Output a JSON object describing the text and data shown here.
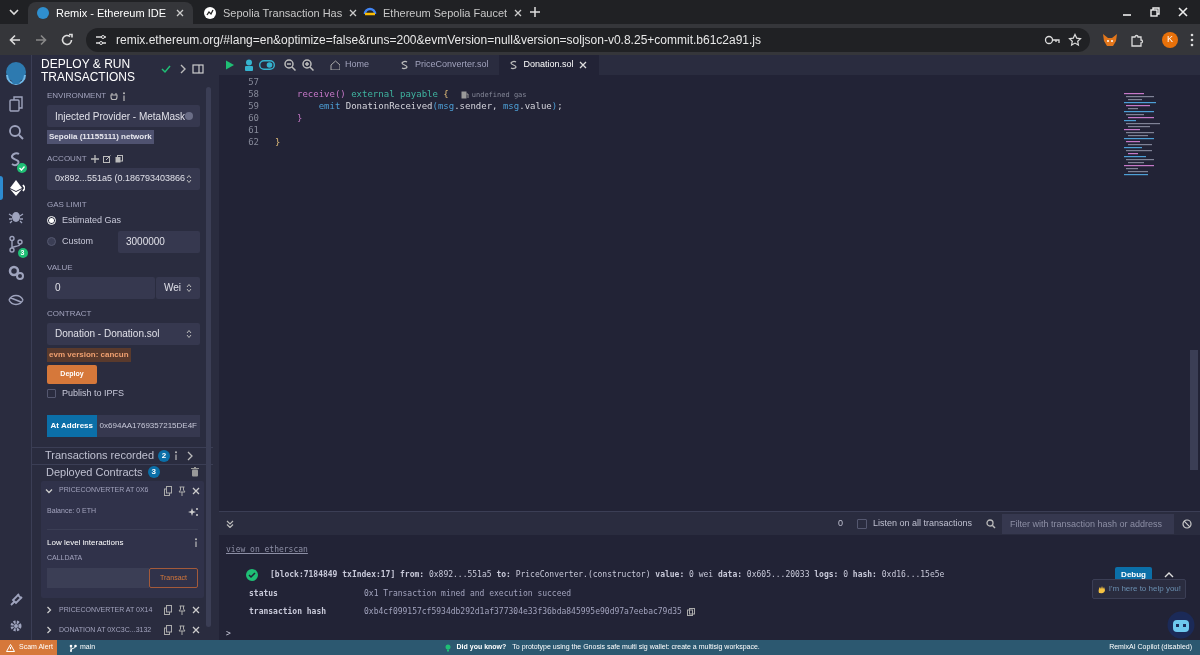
{
  "browser": {
    "tabs": [
      {
        "title": "Remix - Ethereum IDE",
        "selected": true
      },
      {
        "title": "Sepolia Transaction Has",
        "selected": false
      },
      {
        "title": "Ethereum Sepolia Faucet",
        "selected": false
      }
    ],
    "url": "remix.ethereum.org/#lang=en&optimize=false&runs=200&evmVersion=null&version=soljson-v0.8.25+commit.b61c2a91.js",
    "profile": "K"
  },
  "icon_rail": {
    "items": [
      {
        "kind": "files",
        "selected": false
      },
      {
        "kind": "search",
        "selected": false
      },
      {
        "kind": "compiler",
        "selected": false
      },
      {
        "kind": "deploy",
        "selected": true
      },
      {
        "kind": "debug",
        "selected": false
      },
      {
        "kind": "git",
        "selected": false,
        "badge": "3"
      },
      {
        "kind": "settings",
        "selected": false
      },
      {
        "kind": "learn",
        "selected": false
      }
    ]
  },
  "side_panel": {
    "title": "DEPLOY & RUN TRANSACTIONS",
    "environment": {
      "label": "ENVIRONMENT",
      "value": "Injected Provider - MetaMask",
      "network": "Sepolia (11155111) network"
    },
    "account": {
      "label": "ACCOUNT",
      "value": "0x892...551a5 (0.186793403866"
    },
    "gas_limit": {
      "label": "GAS LIMIT",
      "options": [
        {
          "label": "Estimated Gas",
          "selected": true
        },
        {
          "label": "Custom",
          "selected": false
        }
      ],
      "custom_value": "3000000"
    },
    "value": {
      "label": "VALUE",
      "amount": "0",
      "unit": "Wei"
    },
    "contract": {
      "label": "CONTRACT",
      "value": "Donation - Donation.sol",
      "evm_badge": "evm version: cancun"
    },
    "deploy_button": "Deploy",
    "publish": {
      "label": "Publish to IPFS",
      "checked": false
    },
    "at_address": {
      "button": "At Address",
      "value": "0x694AA1769357215DE4F"
    },
    "transactions_recorded": {
      "label": "Transactions recorded",
      "count": "2"
    },
    "deployed": {
      "label": "Deployed Contracts",
      "count": "3",
      "contracts": [
        {
          "name": "PRICECONVERTER AT 0X6",
          "expanded": true
        },
        {
          "name": "PRICECONVERTER AT 0X14",
          "expanded": false
        },
        {
          "name": "DONATION AT 0XC3C...3132",
          "expanded": false
        }
      ],
      "balance": "Balance: 0 ETH",
      "low_level": "Low level interactions",
      "calldata": "CALLDATA",
      "transact": "Transact"
    }
  },
  "editor": {
    "tabs": [
      {
        "label": "Home",
        "kind": "home",
        "selected": false
      },
      {
        "label": "PriceConverter.sol",
        "kind": "file",
        "selected": false
      },
      {
        "label": "Donation.sol",
        "kind": "file",
        "selected": true
      }
    ],
    "lines": [
      {
        "number": "57"
      },
      {
        "number": "58",
        "tokens": [
          {
            "text": "receive()",
            "kind": "fn"
          },
          {
            "text": " external payable",
            "kind": "modifier"
          },
          {
            "text": " {",
            "kind": "brace"
          }
        ],
        "hint": "undefined gas"
      },
      {
        "number": "59",
        "tokens": [
          {
            "text": "    emit",
            "kind": "keyword"
          },
          {
            "text": " DonationReceived"
          },
          {
            "text": "(",
            "kind": "keyword"
          },
          {
            "text": "msg",
            "kind": "keyword"
          },
          {
            "text": ".sender, "
          },
          {
            "text": "msg",
            "kind": "keyword"
          },
          {
            "text": ".value"
          },
          {
            "text": ")",
            "kind": "keyword"
          },
          {
            "text": ";"
          }
        ]
      },
      {
        "number": "60",
        "tokens": [
          {
            "text": "}",
            "kind": "fn"
          }
        ]
      },
      {
        "number": "61"
      },
      {
        "number": "62",
        "tokens": [
          {
            "text": "}",
            "kind": "brace"
          }
        ],
        "outer": true
      }
    ]
  },
  "terminal": {
    "count": "0",
    "listen": {
      "label": "Listen on all transactions",
      "checked": false
    },
    "filter_placeholder": "Filter with transaction hash or address",
    "link": "view on etherscan",
    "summary": "**[block:7184849 txIndex:17]  from:** 0x892...551a5 **to:** PriceConverter.(constructor) **value:** 0 wei **data:** 0x605...20033 **logs:** 0 **hash:** 0xd16...15e5e",
    "debug": "Debug",
    "rows": [
      {
        "key": "status",
        "value": "0x1 Transaction mined and execution succeed"
      },
      {
        "key": "transaction hash",
        "value": "0xb4cf099157cf5934db292d1af377304e33f36bda845995e90d97a7eebac79d35"
      }
    ],
    "prompt": ">",
    "helper": "I'm here to help you!"
  },
  "status_bar": {
    "alert": "Scam Alert",
    "branch": "main",
    "tip_title": "Did you know?",
    "tip": "To prototype using the Gnosis safe multi sig wallet: create a multisig workspace.",
    "copilot": "RemixAI Copilot (disabled)"
  }
}
